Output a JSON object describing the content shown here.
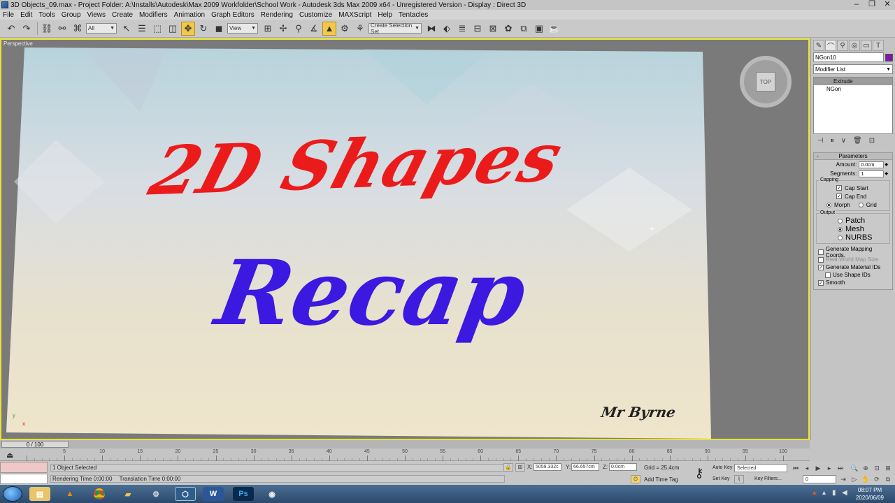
{
  "window": {
    "title": "3D Objects_09.max    - Project Folder: A:\\Installs\\Autodesk\\Max 2009 Workfolder\\School Work    - Autodesk 3ds Max  2009 x64  - Unregistered Version    - Display : Direct 3D",
    "minimize": "–",
    "maximize": "❐",
    "close": "✕"
  },
  "menu": [
    "File",
    "Edit",
    "Tools",
    "Group",
    "Views",
    "Create",
    "Modifiers",
    "Animation",
    "Graph Editors",
    "Rendering",
    "Customize",
    "MAXScript",
    "Help",
    "Tentacles"
  ],
  "toolbar": {
    "selection_filter": "All",
    "ref_coord": "View",
    "named_selection": "Create Selection Set",
    "active_tool_icon": "select-and-move-icon"
  },
  "viewport": {
    "label": "Perspective",
    "viewcube_label": "TOP",
    "axis_x": "x",
    "axis_y": "y"
  },
  "slide": {
    "title": "2D Shapes",
    "subtitle": "Recap",
    "author": "Mr Byrne",
    "title_color": "#ec1b1b",
    "subtitle_color": "#3b19e0"
  },
  "command_panel": {
    "object_name": "NGon10",
    "object_color": "#7a1aa8",
    "modifier_list": "Modifier List",
    "stack": [
      {
        "label": "Extrude",
        "selected": true
      },
      {
        "label": "NGon",
        "selected": false
      }
    ],
    "rollout_title": "Parameters",
    "amount_label": "Amount:",
    "amount_value": "0.0cm",
    "segments_label": "Segments:",
    "segments_value": "1",
    "capping": {
      "label": "Capping",
      "cap_start": "Cap Start",
      "cap_end": "Cap End",
      "morph": "Morph",
      "grid": "Grid"
    },
    "output": {
      "label": "Output",
      "patch": "Patch",
      "mesh": "Mesh",
      "nurbs": "NURBS"
    },
    "options": {
      "gen_mapping": "Generate Mapping Coords.",
      "real_world": "Real-World Map Size",
      "gen_matids": "Generate Material IDs",
      "use_shape_ids": "Use Shape IDs",
      "smooth": "Smooth"
    }
  },
  "timeline": {
    "frame_readout": "0 / 100",
    "labels": [
      "5",
      "10",
      "15",
      "20",
      "25",
      "30",
      "35",
      "40",
      "45",
      "50",
      "55",
      "60",
      "65",
      "70",
      "75",
      "80",
      "85",
      "90",
      "95",
      "100"
    ]
  },
  "status": {
    "selection": "1 Object Selected",
    "rendering_time": "Rendering Time  0:00:00",
    "translation_time": "Translation Time  0:00:00",
    "x_label": "X:",
    "x_value": "5059.332c",
    "y_label": "Y:",
    "y_value": "66.657cm",
    "z_label": "Z:",
    "z_value": "0.0cm",
    "grid": "Grid = 25.4cm",
    "add_time_tag": "Add Time Tag",
    "auto_key": "Auto Key",
    "set_key": "Set Key",
    "selected": "Selected",
    "key_filters": "Key Filters...",
    "frame": "0"
  },
  "taskbar": {
    "apps": [
      "explorer-icon",
      "vlc-icon",
      "chrome-icon",
      "winrar-icon",
      "steam-icon",
      "3dsmax-icon",
      "word-icon",
      "photoshop-icon",
      "obs-icon"
    ],
    "word_letter": "W",
    "ps_letters": "Ps",
    "time": "08:07 PM",
    "date": "2020/06/09"
  }
}
